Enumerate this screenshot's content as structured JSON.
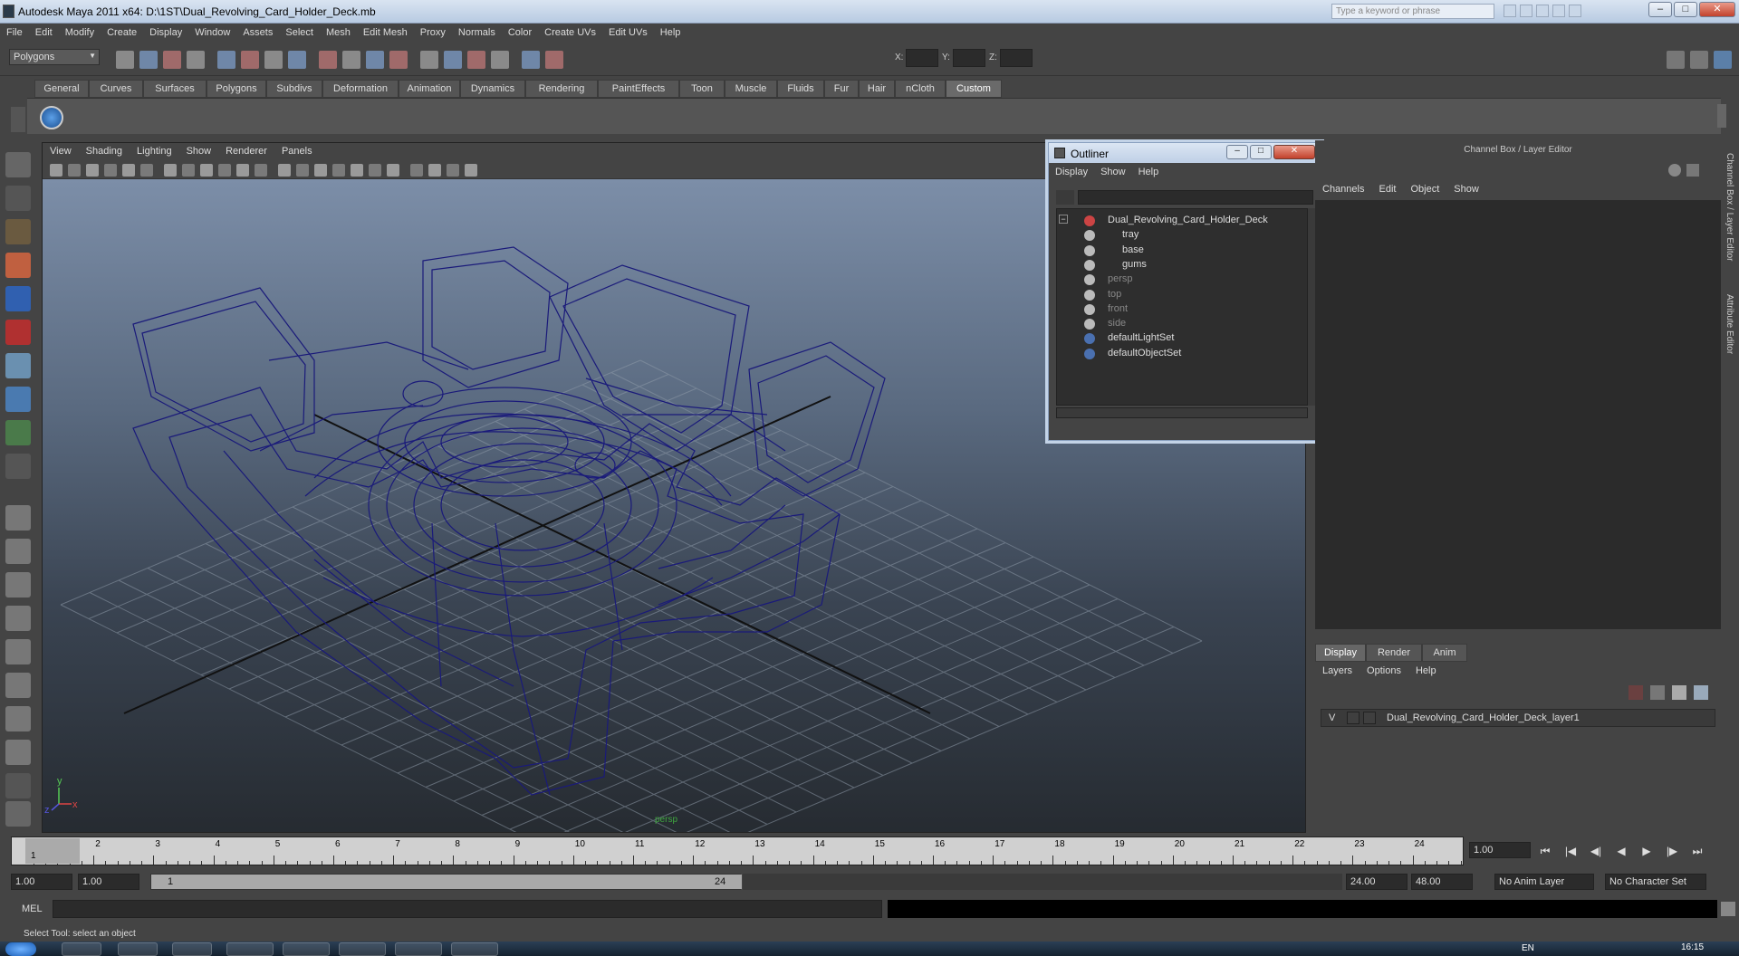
{
  "window": {
    "title": "Autodesk Maya 2011 x64: D:\\1ST\\Dual_Revolving_Card_Holder_Deck.mb",
    "search_placeholder": "Type a keyword or phrase",
    "min": "–",
    "max": "□",
    "close": "✕"
  },
  "menubar": [
    "File",
    "Edit",
    "Modify",
    "Create",
    "Display",
    "Window",
    "Assets",
    "Select",
    "Mesh",
    "Edit Mesh",
    "Proxy",
    "Normals",
    "Color",
    "Create UVs",
    "Edit UVs",
    "Help"
  ],
  "statusline": {
    "mode": "Polygons",
    "x_label": "X:",
    "y_label": "Y:",
    "z_label": "Z:"
  },
  "shelf_tabs": [
    "General",
    "Curves",
    "Surfaces",
    "Polygons",
    "Subdivs",
    "Deformation",
    "Animation",
    "Dynamics",
    "Rendering",
    "PaintEffects",
    "Toon",
    "Muscle",
    "Fluids",
    "Fur",
    "Hair",
    "nCloth",
    "Custom"
  ],
  "shelf_active": "Custom",
  "viewport": {
    "menu": [
      "View",
      "Shading",
      "Lighting",
      "Show",
      "Renderer",
      "Panels"
    ],
    "camera_label": "persp",
    "axis_x": "x",
    "axis_y": "y",
    "axis_z": "z"
  },
  "outliner": {
    "title": "Outliner",
    "menu": [
      "Display",
      "Show",
      "Help"
    ],
    "items": [
      {
        "label": "Dual_Revolving_Card_Holder_Deck",
        "depth": 0,
        "dim": false
      },
      {
        "label": "tray",
        "depth": 1,
        "dim": false
      },
      {
        "label": "base",
        "depth": 1,
        "dim": false
      },
      {
        "label": "gums",
        "depth": 1,
        "dim": false
      },
      {
        "label": "persp",
        "depth": 0,
        "dim": true
      },
      {
        "label": "top",
        "depth": 0,
        "dim": true
      },
      {
        "label": "front",
        "depth": 0,
        "dim": true
      },
      {
        "label": "side",
        "depth": 0,
        "dim": true
      },
      {
        "label": "defaultLightSet",
        "depth": 0,
        "dim": false
      },
      {
        "label": "defaultObjectSet",
        "depth": 0,
        "dim": false
      }
    ],
    "expand_symbol": "−"
  },
  "channelbox": {
    "title": "Channel Box / Layer Editor",
    "menu": [
      "Channels",
      "Edit",
      "Object",
      "Show"
    ]
  },
  "layereditor": {
    "tabs": [
      "Display",
      "Render",
      "Anim"
    ],
    "active_tab": "Display",
    "menu": [
      "Layers",
      "Options",
      "Help"
    ],
    "layer_visibility": "V",
    "layer_name": "Dual_Revolving_Card_Holder_Deck_layer1"
  },
  "sidestrip": {
    "channel_label": "Channel Box / Layer Editor",
    "attr_label": "Attribute Editor"
  },
  "timeline": {
    "ticks": [
      "1",
      "2",
      "3",
      "4",
      "5",
      "6",
      "7",
      "8",
      "9",
      "10",
      "11",
      "12",
      "13",
      "14",
      "15",
      "16",
      "17",
      "18",
      "19",
      "20",
      "21",
      "22",
      "23",
      "24"
    ],
    "current_frame_label": "1",
    "current_time": "1.00"
  },
  "range": {
    "start": "1.00",
    "start2": "1.00",
    "slider_start": "1",
    "slider_end": "24",
    "end": "24.00",
    "end2": "48.00",
    "anim_layer": "No Anim Layer",
    "char_set": "No Character Set"
  },
  "cmdline": {
    "label": "MEL"
  },
  "helpline": {
    "text": "Select Tool: select an object"
  },
  "taskbar": {
    "lang": "EN",
    "clock": "16:15"
  },
  "colors": {
    "wire": "#1a1a7a",
    "accent": "#5b9bd5"
  }
}
